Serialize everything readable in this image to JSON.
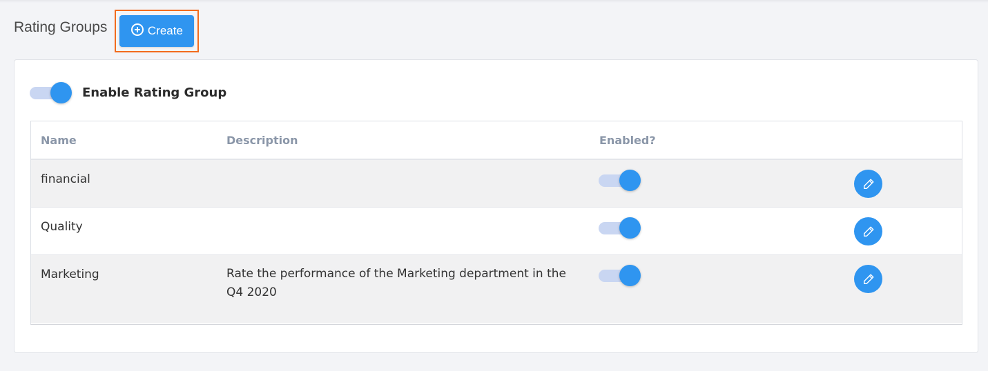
{
  "header": {
    "title": "Rating Groups",
    "create_label": "Create"
  },
  "settings": {
    "enable_label": "Enable Rating Group",
    "enabled": true
  },
  "table": {
    "columns": [
      "Name",
      "Description",
      "Enabled?"
    ],
    "rows": [
      {
        "name": "financial",
        "description": "",
        "enabled": true
      },
      {
        "name": "Quality",
        "description": "",
        "enabled": true
      },
      {
        "name": "Marketing",
        "description": "Rate the  performance of the Marketing department in the Q4 2020",
        "enabled": true
      }
    ]
  },
  "colors": {
    "accent": "#2f95f0",
    "highlight": "#f26b1d",
    "toggle_track": "#c9d6f2"
  },
  "icons": {
    "create": "plus-circle-icon",
    "edit": "pencil-icon"
  }
}
